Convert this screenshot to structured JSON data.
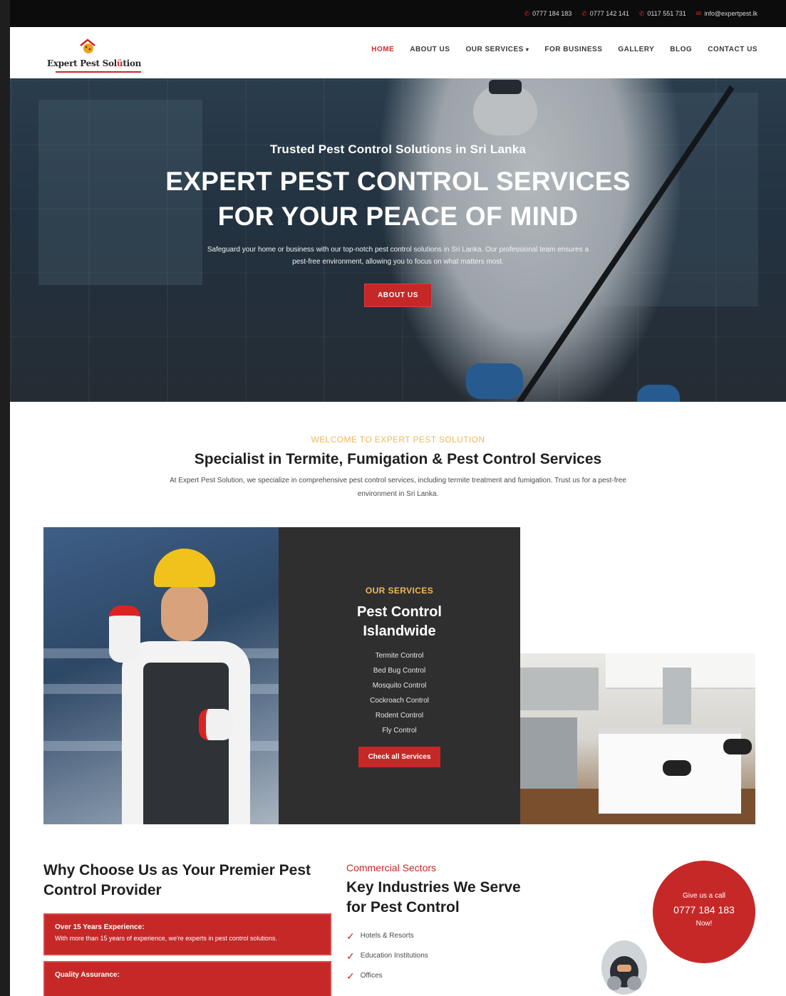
{
  "topbar": {
    "phone1": "0777 184 183",
    "phone2": "0777 142 141",
    "phone3": "0117 551 731",
    "email": "info@expertpest.lk"
  },
  "brand": {
    "name_part1": "Expert Pest Sol",
    "name_accent": "ü",
    "name_part2": "tion",
    "accent_color": "#c62828"
  },
  "nav": {
    "items": [
      "HOME",
      "ABOUT US",
      "OUR SERVICES",
      "FOR BUSINESS",
      "GALLERY",
      "BLOG",
      "CONTACT US"
    ],
    "active": "HOME"
  },
  "hero": {
    "subtitle": "Trusted Pest Control Solutions in Sri Lanka",
    "title": "EXPERT PEST CONTROL SERVICES FOR YOUR PEACE OF MIND",
    "description": "Safeguard your home or business with our top-notch pest control solutions in Sri Lanka. Our professional team ensures a pest-free environment, allowing you to focus on what matters most.",
    "button": "ABOUT US"
  },
  "welcome": {
    "eyebrow": "WELCOME TO EXPERT PEST SOLUTION",
    "heading": "Specialist in Termite, Fumigation & Pest Control Services",
    "description": "At Expert Pest Solution, we specialize in comprehensive pest control services, including termite treatment and fumigation. Trust us for a pest-free environment in Sri Lanka."
  },
  "services": {
    "eyebrow": "OUR SERVICES",
    "title_line1": "Pest Control",
    "title_line2": "Islandwide",
    "list": [
      "Termite Control",
      "Bed Bug Control",
      "Mosquito Control",
      "Cockroach Control",
      "Rodent Control",
      "Fly Control"
    ],
    "button": "Check all Services"
  },
  "why": {
    "heading": "Why Choose Us as Your Premier Pest Control Provider",
    "cards": [
      {
        "title": "Over 15 Years Experience:",
        "desc": "With more than 15 years of experience, we're experts in pest control solutions."
      },
      {
        "title": "Quality Assurance:",
        "desc": ""
      }
    ]
  },
  "industries": {
    "eyebrow": "Commercial Sectors",
    "heading": "Key Industries We Serve for Pest Control",
    "list": [
      "Hotels & Resorts",
      "Education Institutions",
      "Offices"
    ]
  },
  "call": {
    "line1": "Give us a call",
    "number": "0777 184 183",
    "line3": "Now!"
  },
  "icons": {
    "phone": "phone-icon",
    "email": "email-icon",
    "check": "check-circle-icon",
    "dropdown": "chevron-down-icon"
  }
}
